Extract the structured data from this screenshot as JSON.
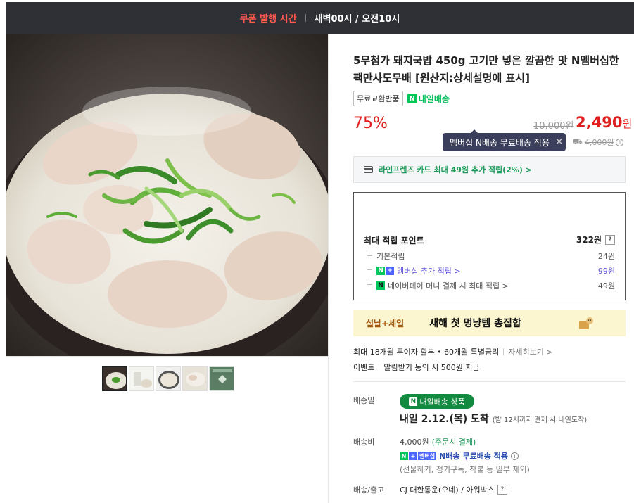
{
  "topbar": {
    "coupon_label": "쿠폰 발행 시간",
    "time": "새벽00시 / 오전10시"
  },
  "product": {
    "title": "5무첨가 돼지국밥 450g 고기만 넣은 깔끔한 맛 N멤버십한팩만사도무배 [원산지:상세설명에 표시]",
    "badge_return": "무료교환반품",
    "badge_delivery": "내일배송",
    "discount": "75%",
    "original_price": "10,000원",
    "sale_price": "2,490",
    "currency": "원"
  },
  "tooltip": {
    "text": "멤버십 N배송 무료배송 적용",
    "close": "✕"
  },
  "shipping_strike": {
    "value": "4,000원"
  },
  "card_benefit": {
    "text": "라인프렌즈 카드 최대 49원 추가 적립(2%) >"
  },
  "points": {
    "title": "최대 적립 포인트",
    "total": "322원",
    "help": "?",
    "rows": [
      {
        "label": "기본적립",
        "value": "24원"
      },
      {
        "label": "멤버십 추가 적립 >",
        "value": "99원"
      },
      {
        "label": "네이버페이 머니 결제 시 최대 적립 >",
        "value": "49원"
      }
    ]
  },
  "banner": {
    "tag": "설날+세일",
    "text": "새해 첫 멍냥템 총집합"
  },
  "installment": {
    "text": "최대 18개월 무이자 할부 • 60개월 특별금리",
    "link": "자세히보기 >"
  },
  "event": {
    "label": "이벤트",
    "text": "알림받기 동의 시 500원 지급"
  },
  "delivery": {
    "date_label": "배송일",
    "pill": "내일배송 상품",
    "arrival": "내일 2.12.(목) 도착",
    "arrival_note": "(밤 12시까지 결제 시 내일도착)",
    "fee_label": "배송비",
    "fee_original": "4,000원",
    "fee_note": "(주문시 결제)",
    "membership_badge": "멤버십",
    "free_text": "N배송 무료배송 적용",
    "exceptions": "(선물하기, 정기구독, 착불 등 일부 제외)",
    "carrier_label": "배송/출고",
    "carrier": "CJ 대한통운(오네) / 아워박스"
  },
  "colors": {
    "accent_red": "#e02020",
    "naver_green": "#03c75a",
    "tooltip_bg": "#3b3e5b"
  }
}
